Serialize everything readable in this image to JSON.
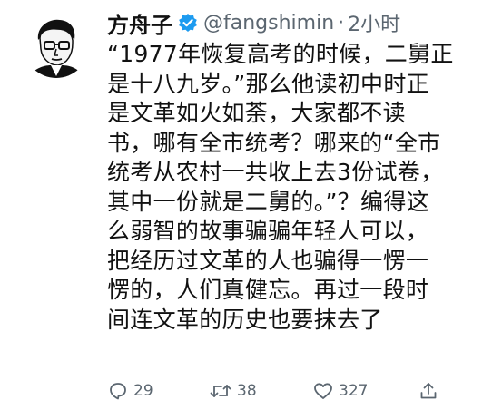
{
  "author": {
    "display_name": "方舟子",
    "handle": "@fangshimin",
    "separator": "·",
    "time": "2小时",
    "verified_color": "#1d9bf0"
  },
  "tweet": {
    "lines": [
      "“1977年恢复高考的时候，二舅正",
      "是十八九岁。”那么他读初中时正",
      "是文革如火如荼，大家都不读",
      "书，哪有全市统考？哪来的“全市",
      "统考从农村一共收上去3份试卷，",
      "其中一份就是二舅的。”？编得这",
      "么弱智的故事骗骗年轻人可以，",
      "把经历过文革的人也骗得一愣一",
      "愣的，人们真健忘。再过一段时",
      "间连文革的历史也要抹去了"
    ]
  },
  "actions": {
    "replies": "29",
    "retweets": "38",
    "likes": "327",
    "icon_color": "#5b6670"
  }
}
